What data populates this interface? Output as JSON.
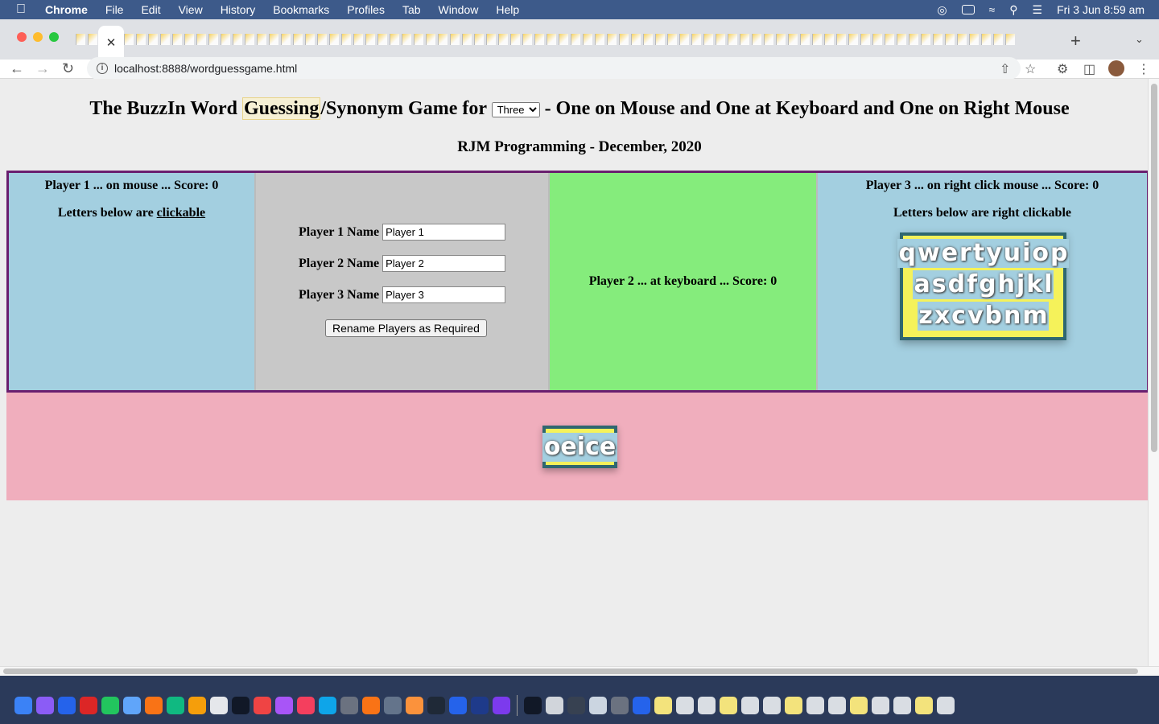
{
  "menubar": {
    "app_name": "Chrome",
    "items": [
      "File",
      "Edit",
      "View",
      "History",
      "Bookmarks",
      "Profiles",
      "Tab",
      "Window",
      "Help"
    ],
    "clock": "Fri 3 Jun  8:59 am"
  },
  "browser": {
    "url": "localhost:8888/wordguessgame.html",
    "active_tab_close": "✕",
    "new_tab": "+"
  },
  "page": {
    "title_pre": "The BuzzIn Word ",
    "title_highlight": "Guessing",
    "title_mid": "/Synonym Game for ",
    "player_count": "Three",
    "player_count_options": [
      "Three"
    ],
    "title_post": " - One on Mouse and One at Keyboard and One on Right Mouse",
    "subtitle": "RJM Programming - December, 2020"
  },
  "player1": {
    "status": "Player 1 ... on mouse ... Score: 0",
    "hint_pre": "Letters below are ",
    "hint_link": "clickable"
  },
  "form": {
    "p1_label": "Player 1 Name",
    "p1_value": "Player 1",
    "p2_label": "Player 2 Name",
    "p2_value": "Player 2",
    "p3_label": "Player 3 Name",
    "p3_value": "Player 3",
    "rename_button": "Rename Players as Required"
  },
  "player2": {
    "status": "Player 2 ... at keyboard ... Score: 0"
  },
  "player3": {
    "status": "Player 3 ... on right click mouse ... Score: 0",
    "hint": "Letters below are right clickable",
    "keyboard_rows": [
      "qwertyuiop",
      "asdfghjkl",
      "zxcvbnm"
    ]
  },
  "answer": {
    "letters": "oeice"
  },
  "colors": {
    "board_border": "#6a1f6f",
    "player_panel": "#a3cfe0",
    "keyboard_panel": "#85ec7c",
    "form_panel": "#c8c8c8",
    "answer_area": "#f0aebd",
    "tile_bg": "#f5f25a",
    "tile_border": "#2f6770"
  }
}
